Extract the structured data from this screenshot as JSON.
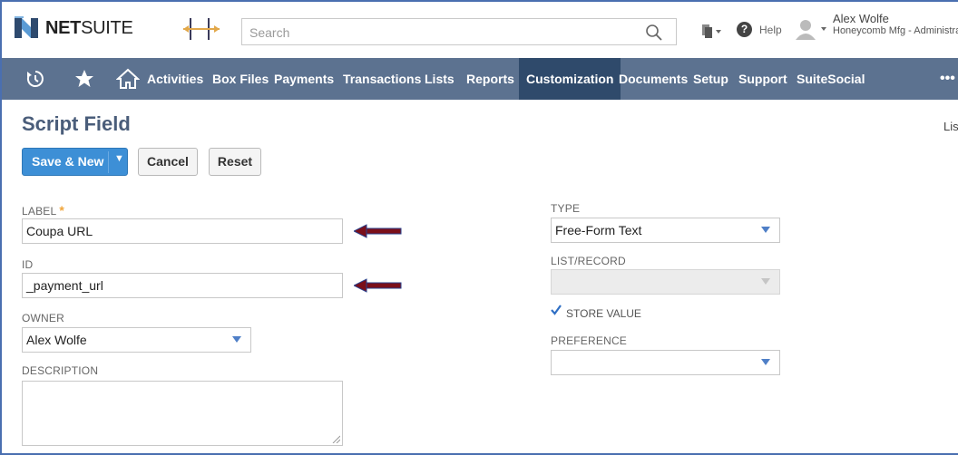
{
  "header": {
    "logo_text_bold": "NET",
    "logo_text": "SUITE",
    "search_placeholder": "Search",
    "help_label": "Help",
    "user_name": "Alex Wolfe",
    "user_role": "Honeycomb Mfg - Administrator"
  },
  "nav": {
    "items": [
      "Activities",
      "Box Files",
      "Payments",
      "Transactions",
      "Lists",
      "Reports",
      "Customization",
      "Documents",
      "Setup",
      "Support",
      "SuiteSocial"
    ],
    "active": "Customization",
    "more": "•••"
  },
  "page": {
    "title": "Script Field",
    "list_link": "Lis"
  },
  "buttons": {
    "save_new": "Save & New",
    "cancel": "Cancel",
    "reset": "Reset"
  },
  "form": {
    "label": {
      "caption": "LABEL",
      "required_mark": "*",
      "value": "Coupa URL"
    },
    "id": {
      "caption": "ID",
      "value": "_payment_url"
    },
    "owner": {
      "caption": "OWNER",
      "value": "Alex Wolfe"
    },
    "description": {
      "caption": "DESCRIPTION",
      "value": ""
    },
    "type": {
      "caption": "TYPE",
      "value": "Free-Form Text"
    },
    "list_record": {
      "caption": "LIST/RECORD",
      "value": ""
    },
    "store_value": {
      "caption": "STORE VALUE",
      "checked": true
    },
    "preference": {
      "caption": "PREFERENCE",
      "value": ""
    }
  },
  "colors": {
    "nav_bg": "#5c7290",
    "nav_active": "#2f4a6b",
    "primary_button": "#3d8fd6",
    "annotation_arrow": "#7a0f1a"
  }
}
